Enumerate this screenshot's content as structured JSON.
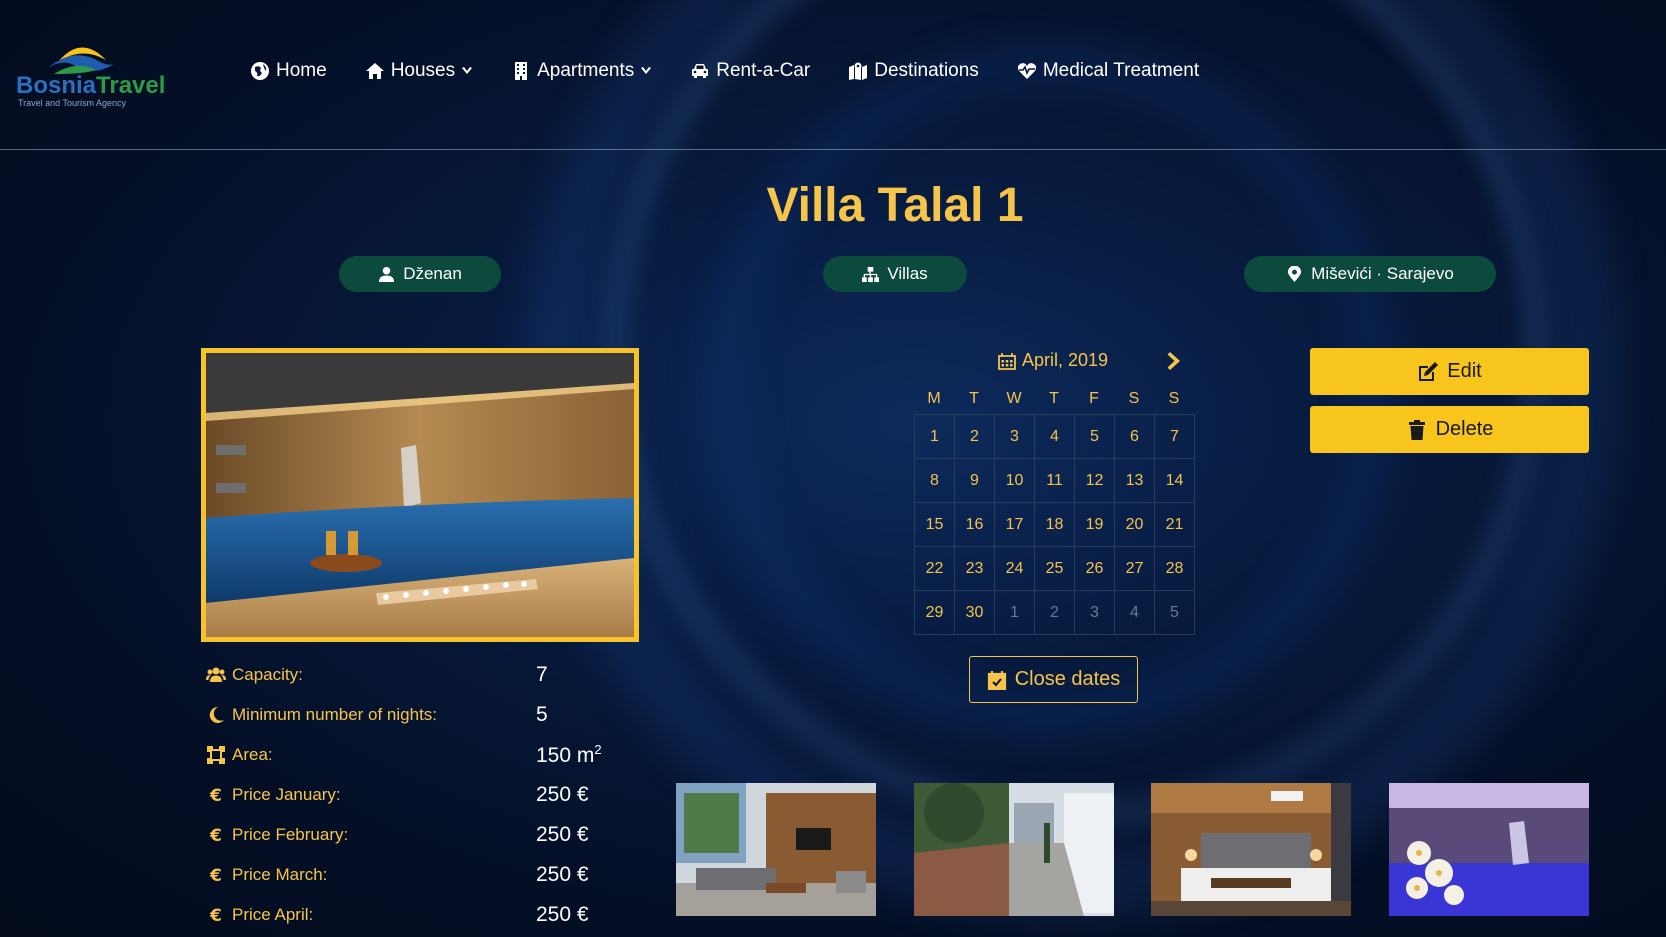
{
  "brand": {
    "name_part1": "Bosnia",
    "name_part2": "Travel",
    "tagline": "Travel and Tourism Agency",
    "colors": {
      "primary_blue": "#2a6fc2",
      "green": "#2d9a45",
      "accent": "#f6c44a",
      "pill_bg": "#0b4a3c"
    }
  },
  "nav": [
    {
      "label": "Home",
      "icon": "globe-icon",
      "dropdown": false
    },
    {
      "label": "Houses",
      "icon": "house-icon",
      "dropdown": true
    },
    {
      "label": "Apartments",
      "icon": "building-icon",
      "dropdown": true
    },
    {
      "label": "Rent-a-Car",
      "icon": "car-icon",
      "dropdown": false
    },
    {
      "label": "Destinations",
      "icon": "map-icon",
      "dropdown": false
    },
    {
      "label": "Medical Treatment",
      "icon": "heartbeat-icon",
      "dropdown": false
    }
  ],
  "listing": {
    "title": "Villa Talal 1",
    "owner": "Dženan",
    "type": "Villas",
    "location": "Miševići · Sarajevo"
  },
  "specs": [
    {
      "icon": "users-icon",
      "label": "Capacity:",
      "value": "7"
    },
    {
      "icon": "moon-icon",
      "label": "Minimum number of nights:",
      "value": "5"
    },
    {
      "icon": "area-icon",
      "label": "Area:",
      "value": "150 m",
      "unit_sup": "2"
    },
    {
      "icon": "euro-icon",
      "label": "Price January:",
      "value": "250 €"
    },
    {
      "icon": "euro-icon",
      "label": "Price February:",
      "value": "250 €"
    },
    {
      "icon": "euro-icon",
      "label": "Price March:",
      "value": "250 €"
    },
    {
      "icon": "euro-icon",
      "label": "Price April:",
      "value": "250 €"
    }
  ],
  "calendar": {
    "month_label": "April, 2019",
    "weekdays": [
      "M",
      "T",
      "W",
      "T",
      "F",
      "S",
      "S"
    ],
    "days": [
      [
        "1",
        "2",
        "3",
        "4",
        "5",
        "6",
        "7"
      ],
      [
        "8",
        "9",
        "10",
        "11",
        "12",
        "13",
        "14"
      ],
      [
        "15",
        "16",
        "17",
        "18",
        "19",
        "20",
        "21"
      ],
      [
        "22",
        "23",
        "24",
        "25",
        "26",
        "27",
        "28"
      ],
      [
        "29",
        "30",
        "1",
        "2",
        "3",
        "4",
        "5"
      ]
    ],
    "muted_from_index": 30,
    "close_dates_label": "Close dates"
  },
  "actions": {
    "edit_label": "Edit",
    "delete_label": "Delete"
  }
}
